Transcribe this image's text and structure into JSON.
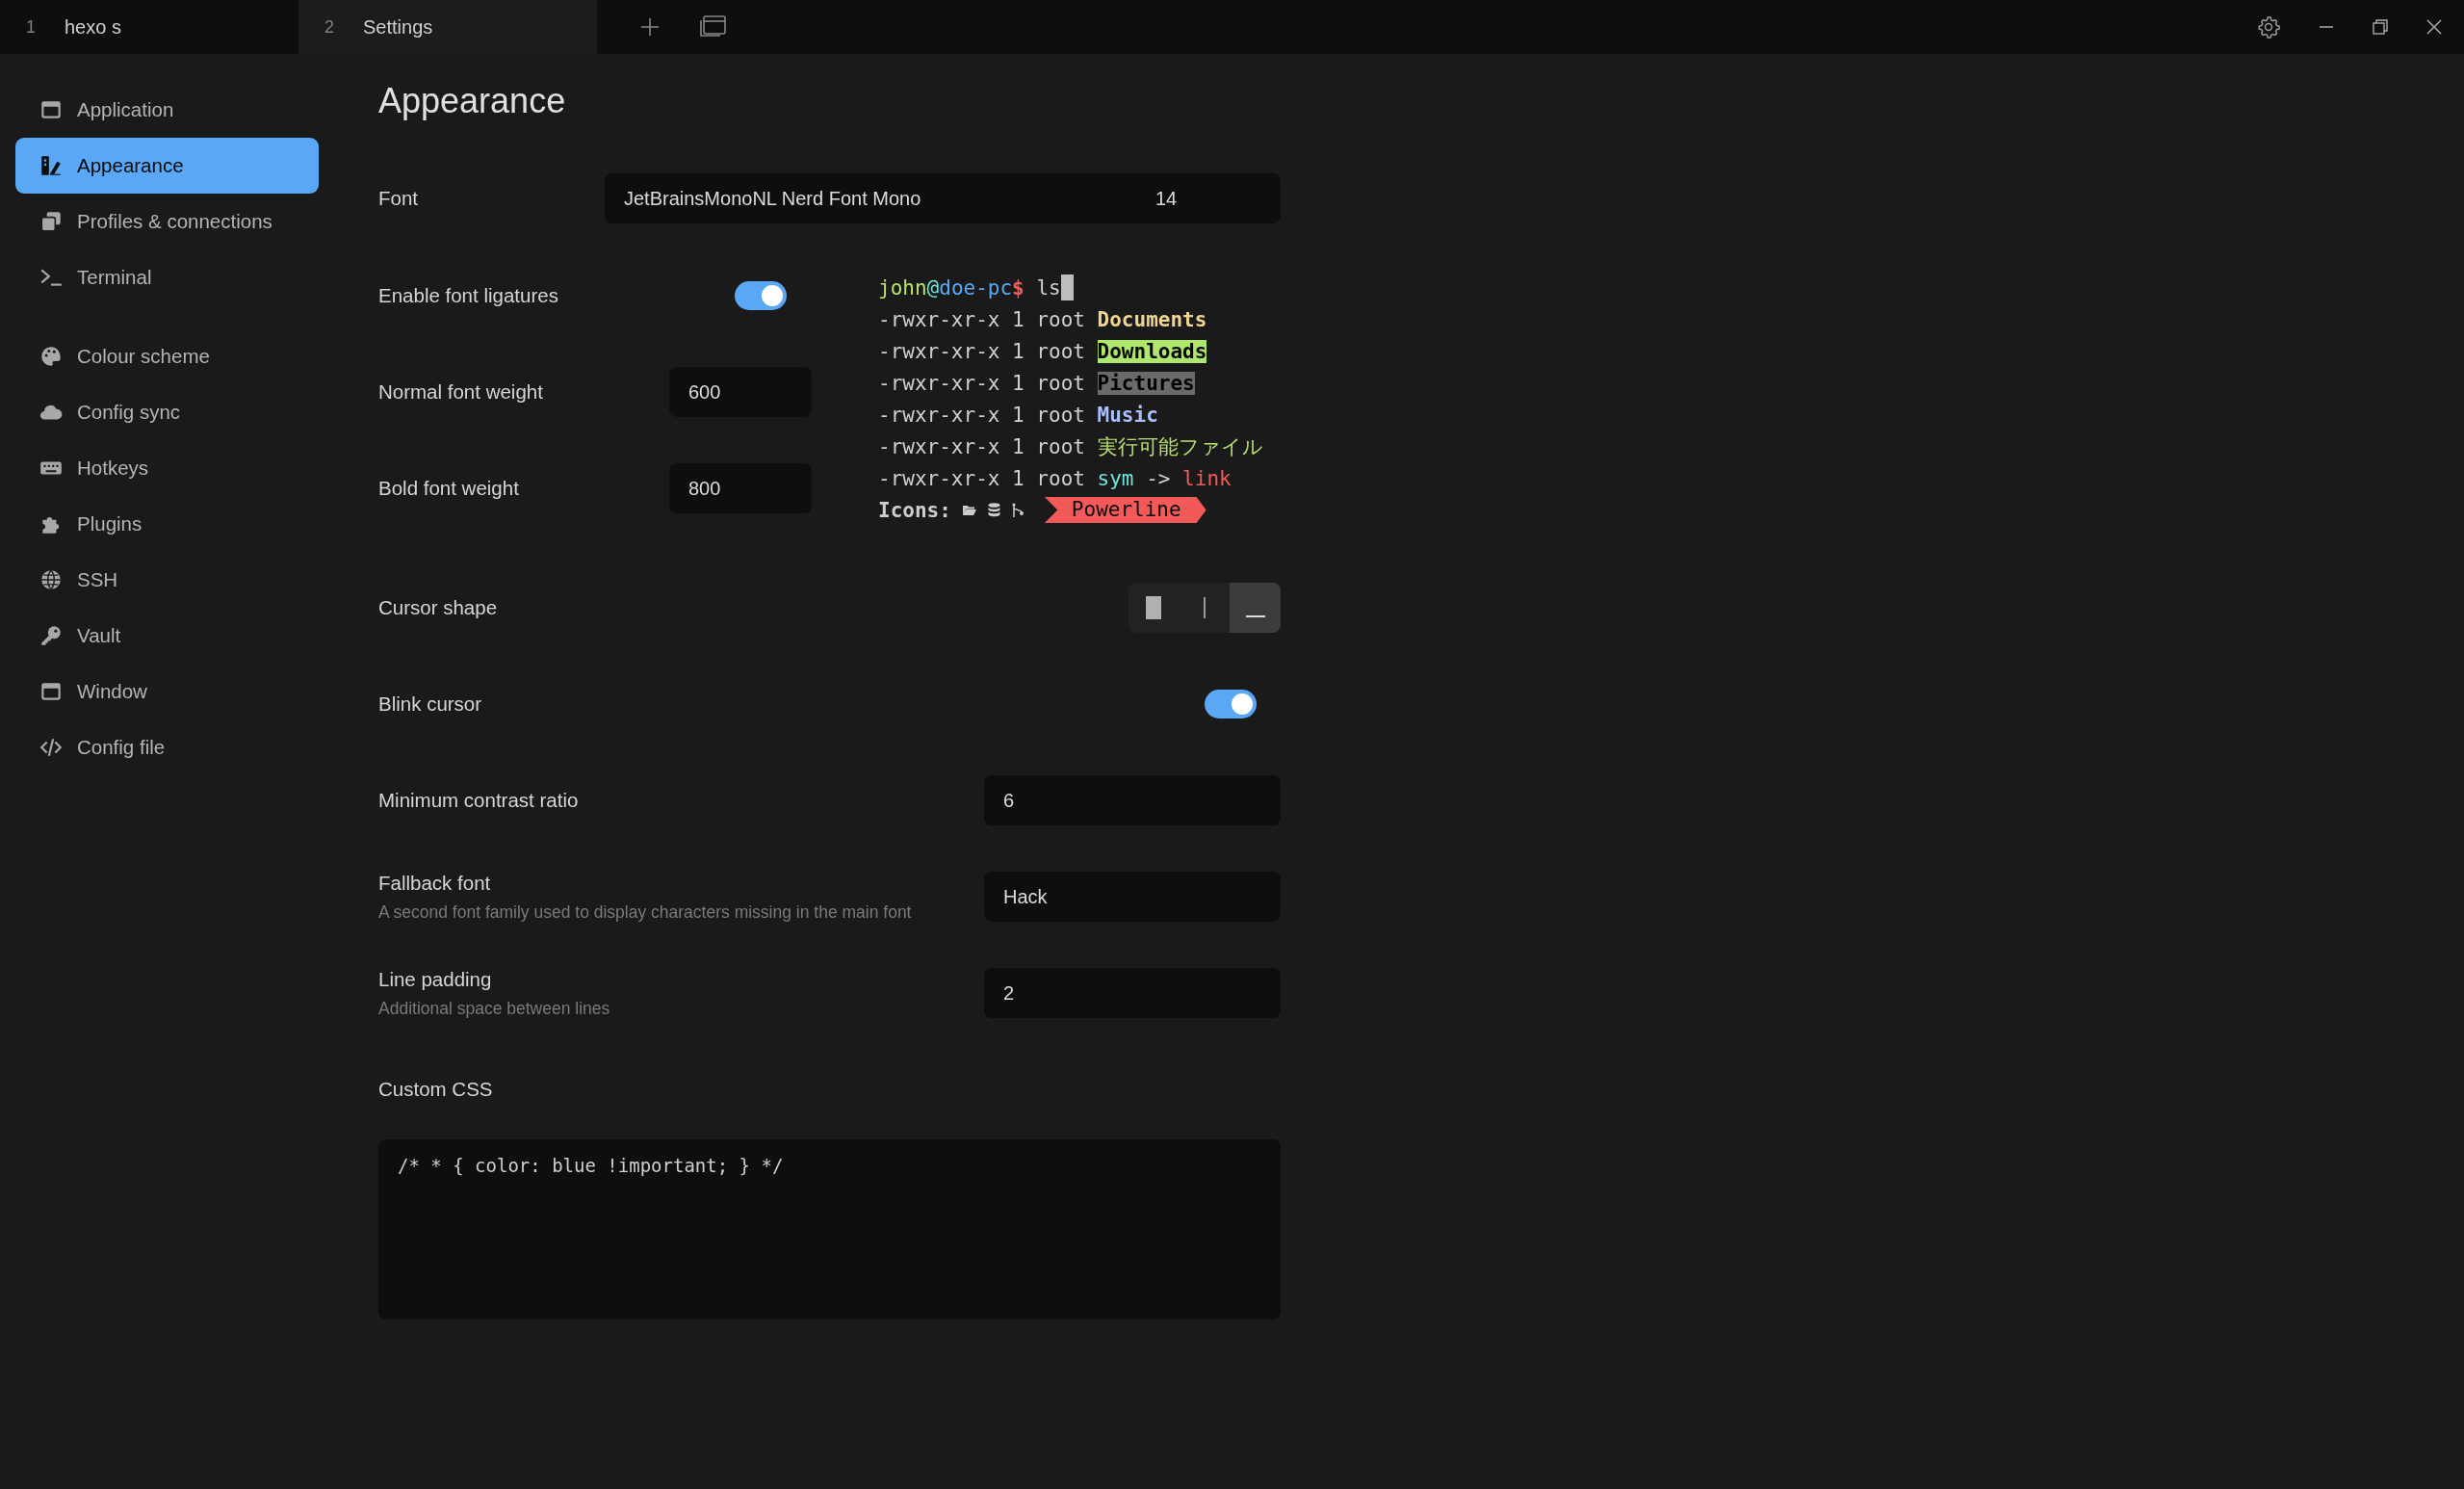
{
  "tabs": [
    {
      "number": "1",
      "label": "hexo s",
      "selected": false
    },
    {
      "number": "2",
      "label": "Settings",
      "selected": true
    }
  ],
  "sidebar": {
    "groups": [
      [
        {
          "label": "Application",
          "selected": false
        },
        {
          "label": "Appearance",
          "selected": true
        },
        {
          "label": "Profiles & connections",
          "selected": false
        },
        {
          "label": "Terminal",
          "selected": false
        }
      ],
      [
        {
          "label": "Colour scheme",
          "selected": false
        },
        {
          "label": "Config sync",
          "selected": false
        },
        {
          "label": "Hotkeys",
          "selected": false
        },
        {
          "label": "Plugins",
          "selected": false
        },
        {
          "label": "SSH",
          "selected": false
        },
        {
          "label": "Vault",
          "selected": false
        },
        {
          "label": "Window",
          "selected": false
        },
        {
          "label": "Config file",
          "selected": false
        }
      ]
    ]
  },
  "page": {
    "title": "Appearance",
    "font": {
      "label": "Font",
      "family": "JetBrainsMonoNL Nerd Font Mono",
      "size": "14"
    },
    "ligatures": {
      "label": "Enable font ligatures",
      "on": true
    },
    "normal_weight": {
      "label": "Normal font weight",
      "value": "600"
    },
    "bold_weight": {
      "label": "Bold font weight",
      "value": "800"
    },
    "preview": {
      "lines": [
        {
          "segments": [
            {
              "text": "john",
              "kind": "user"
            },
            {
              "text": "@",
              "kind": "at"
            },
            {
              "text": "doe-pc",
              "kind": "host"
            },
            {
              "text": "$",
              "kind": "dollar"
            },
            {
              "text": " ls",
              "kind": "plain"
            }
          ],
          "cursor": true
        },
        {
          "segments": [
            {
              "text": "-rwxr-xr-x 1 root ",
              "kind": "plain"
            },
            {
              "text": "Documents",
              "kind": "dir"
            }
          ],
          "cursor": false
        },
        {
          "segments": [
            {
              "text": "-rwxr-xr-x 1 root ",
              "kind": "plain"
            },
            {
              "text": "Downloads",
              "kind": "sticky"
            }
          ],
          "cursor": false
        },
        {
          "segments": [
            {
              "text": "-rwxr-xr-x 1 root ",
              "kind": "plain"
            },
            {
              "text": "Pictures",
              "kind": "dim"
            }
          ],
          "cursor": false
        },
        {
          "segments": [
            {
              "text": "-rwxr-xr-x 1 root ",
              "kind": "plain"
            },
            {
              "text": "Music",
              "kind": "music"
            }
          ],
          "cursor": false
        },
        {
          "segments": [
            {
              "text": "-rwxr-xr-x 1 root ",
              "kind": "plain"
            },
            {
              "text": "実行可能ファイル",
              "kind": "exec"
            }
          ],
          "cursor": false
        },
        {
          "segments": [
            {
              "text": "-rwxr-xr-x 1 root ",
              "kind": "plain"
            },
            {
              "text": "sym",
              "kind": "sym"
            },
            {
              "text": " -> ",
              "kind": "plain"
            },
            {
              "text": "link",
              "kind": "link"
            }
          ],
          "cursor": false
        }
      ],
      "icons_label": "Icons:",
      "powerline": "Powerline"
    },
    "cursor_shape": {
      "label": "Cursor shape",
      "options": [
        {
          "kind": "block",
          "selected": false
        },
        {
          "kind": "beam",
          "selected": false
        },
        {
          "kind": "underline",
          "selected": true
        }
      ]
    },
    "blink": {
      "label": "Blink cursor",
      "on": true
    },
    "contrast": {
      "label": "Minimum contrast ratio",
      "value": "6"
    },
    "fallback": {
      "label": "Fallback font",
      "description": "A second font family used to display characters missing in the main font",
      "value": "Hack"
    },
    "line_padding": {
      "label": "Line padding",
      "description": "Additional space between lines",
      "value": "2"
    },
    "custom_css": {
      "label": "Custom CSS",
      "value": "/* * { color: blue !important; } */"
    }
  }
}
